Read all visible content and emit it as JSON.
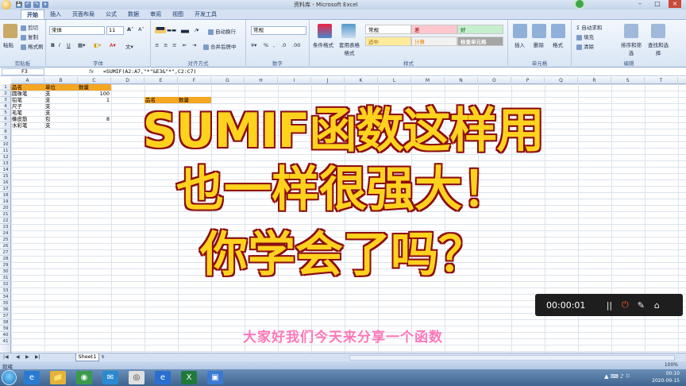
{
  "window": {
    "title": "资料库 - Microsoft Excel",
    "qat": [
      "💾",
      "↶",
      "↷",
      "▾"
    ]
  },
  "ribbon_tabs": [
    "开始",
    "插入",
    "页面布局",
    "公式",
    "数据",
    "审阅",
    "视图",
    "开发工具"
  ],
  "clipboard": {
    "paste": "粘贴",
    "cut": "剪切",
    "copy": "复制",
    "format_painter": "格式刷",
    "label": "剪贴板"
  },
  "font": {
    "name": "宋体",
    "size": "11",
    "label": "字体",
    "bold": "B",
    "italic": "I",
    "underline": "U"
  },
  "alignment": {
    "wrap": "自动换行",
    "merge": "合并后居中",
    "label": "对齐方式"
  },
  "number": {
    "format": "常规",
    "label": "数字"
  },
  "styles": {
    "conditional": "条件格式",
    "table": "套用表格格式",
    "cells": [
      {
        "text": "常规",
        "bg": "#ffffff"
      },
      {
        "text": "差",
        "bg": "#ffc7ce",
        "color": "#9c0006"
      },
      {
        "text": "好",
        "bg": "#c6efce",
        "color": "#006100"
      },
      {
        "text": "适中",
        "bg": "#ffeb9c",
        "color": "#9c6500"
      },
      {
        "text": "计算",
        "bg": "#f2f2f2",
        "color": "#fa7d00"
      },
      {
        "text": "检查单元格",
        "bg": "#a5a5a5",
        "color": "#ffffff"
      }
    ],
    "label": "样式"
  },
  "cells_group": {
    "insert": "插入",
    "delete": "删除",
    "format": "格式",
    "label": "单元格"
  },
  "editing": {
    "autosum": "自动求和",
    "fill": "填充",
    "clear": "清除",
    "sort": "排序和筛选",
    "find": "查找和选择",
    "label": "编辑"
  },
  "formula_bar": {
    "name_box": "F3",
    "fx": "fx",
    "formula": "=SUMIF(A2:A7,\"*\"&E3&\"*\",C2:C7)"
  },
  "columns": [
    "A",
    "B",
    "C",
    "D",
    "E",
    "F",
    "G",
    "H",
    "I",
    "J",
    "K",
    "L",
    "M",
    "N",
    "O",
    "P",
    "Q",
    "R",
    "S",
    "T"
  ],
  "rows": [
    "1",
    "2",
    "3",
    "4",
    "5",
    "6",
    "7",
    "8",
    "9",
    "10",
    "11",
    "12",
    "13",
    "14",
    "15",
    "16",
    "17",
    "18",
    "19",
    "20",
    "21",
    "22",
    "23",
    "24",
    "25",
    "26",
    "27",
    "28",
    "29",
    "30",
    "31",
    "32",
    "33",
    "34",
    "35",
    "36",
    "37",
    "38",
    "39",
    "40",
    "41"
  ],
  "table": {
    "headers": [
      "品名",
      "单位",
      "数量"
    ],
    "rows": [
      [
        "圆珠笔",
        "支",
        "100"
      ],
      [
        "铅笔",
        "支",
        "1"
      ],
      [
        "尺子",
        "支",
        ""
      ],
      [
        "毛笔",
        "支",
        ""
      ],
      [
        "橡皮筋",
        "包",
        "8"
      ],
      [
        "水彩笔",
        "支",
        ""
      ]
    ],
    "lookup_headers": [
      "品名",
      "数量"
    ]
  },
  "overlay": {
    "line1": "SUMIF函数这样用",
    "line2": "也一样很强大！",
    "line3": "你学会了吗？"
  },
  "subtitle": "大家好我们今天来分享一个函数",
  "recorder": {
    "time": "00:00:01",
    "pause": "||",
    "stop": "⏻",
    "pen": "✎",
    "home": "⌂"
  },
  "sheet_tabs": {
    "active": "Sheet1",
    "new": "↯"
  },
  "status": {
    "ready": "就绪",
    "zoom": "100%"
  },
  "taskbar": {
    "time": "00:10",
    "date": "2020-09-15",
    "apps": [
      "e",
      "📁",
      "◉",
      "✉",
      "◎",
      "e",
      "X",
      "▣"
    ]
  }
}
